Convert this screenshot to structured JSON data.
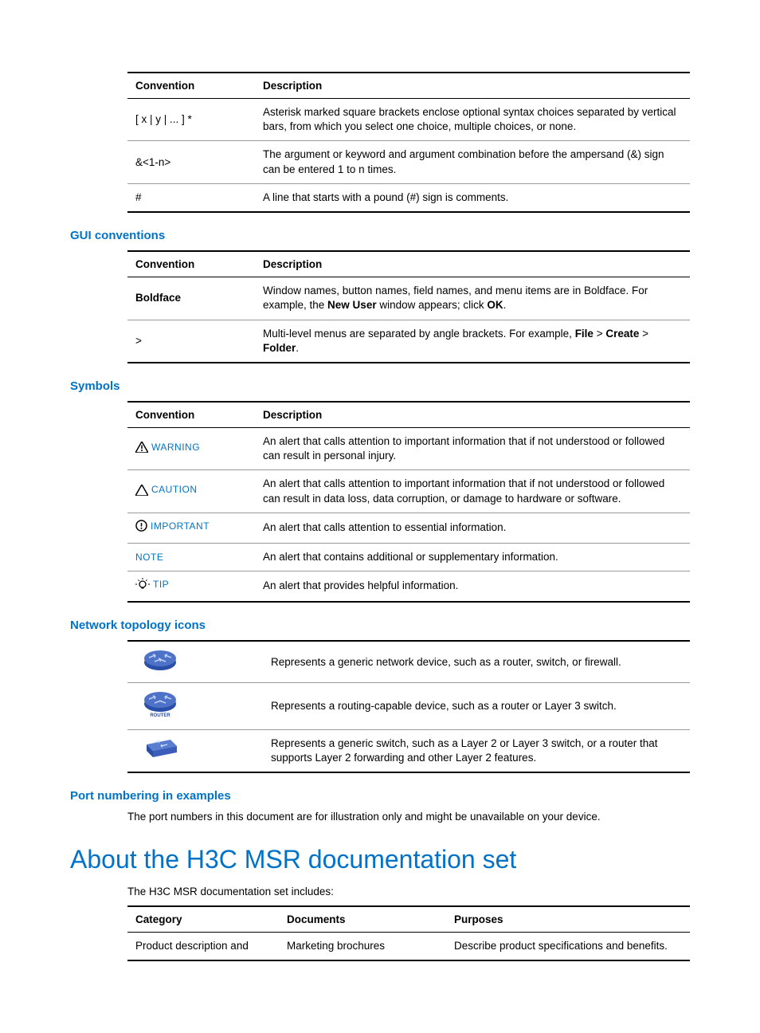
{
  "table1": {
    "head": {
      "c1": "Convention",
      "c2": "Description"
    },
    "rows": [
      {
        "c1": "[ x | y | ... ] *",
        "c2": "Asterisk marked square brackets enclose optional syntax choices separated by vertical bars, from which you select one choice, multiple choices, or none."
      },
      {
        "c1": "&<1-n>",
        "c2": "The argument or keyword and argument combination before the ampersand (&) sign can be entered 1 to n times."
      },
      {
        "c1": "#",
        "c2": "A line that starts with a pound (#) sign is comments."
      }
    ]
  },
  "sect_gui": "GUI conventions",
  "table2": {
    "head": {
      "c1": "Convention",
      "c2": "Description"
    },
    "rows": [
      {
        "c1": "Boldface",
        "c2_pre": "Window names, button names, field names, and menu items are in Boldface. For example, the ",
        "c2_b1": "New User",
        "c2_mid": " window appears; click ",
        "c2_b2": "OK",
        "c2_post": "."
      },
      {
        "c1": ">",
        "c2_pre": "Multi-level menus are separated by angle brackets. For example, ",
        "c2_b1": "File",
        "c2_s1": " > ",
        "c2_b2": "Create",
        "c2_s2": " > ",
        "c2_b3": "Folder",
        "c2_post": "."
      }
    ]
  },
  "sect_symbols": "Symbols",
  "table3": {
    "head": {
      "c1": "Convention",
      "c2": "Description"
    },
    "rows": [
      {
        "label": "WARNING",
        "desc": "An alert that calls attention to important information that if not understood or followed can result in personal injury."
      },
      {
        "label": "CAUTION",
        "desc": "An alert that calls attention to important information that if not understood or followed can result in data loss, data corruption, or damage to hardware or software."
      },
      {
        "label": "IMPORTANT",
        "desc": "An alert that calls attention to essential information."
      },
      {
        "label": "NOTE",
        "desc": "An alert that contains additional or supplementary information."
      },
      {
        "label": "TIP",
        "desc": "An alert that provides helpful information."
      }
    ]
  },
  "sect_topo": "Network topology icons",
  "table4": {
    "rows": [
      {
        "desc": "Represents a generic network device, such as a router, switch, or firewall."
      },
      {
        "desc": "Represents a routing-capable device, such as a router or Layer 3 switch."
      },
      {
        "desc": "Represents a generic switch, such as a Layer 2 or Layer 3 switch, or a router that supports Layer 2 forwarding and other Layer 2 features."
      }
    ]
  },
  "sect_port": "Port numbering in examples",
  "port_text": "The port numbers in this document are for illustration only and might be unavailable on your device.",
  "about_title": "About the H3C MSR documentation set",
  "about_intro": "The H3C MSR documentation set includes:",
  "table5": {
    "head": {
      "c1": "Category",
      "c2": "Documents",
      "c3": "Purposes"
    },
    "row": {
      "c1": "Product description and",
      "c2": "Marketing brochures",
      "c3": "Describe product specifications and benefits."
    }
  }
}
